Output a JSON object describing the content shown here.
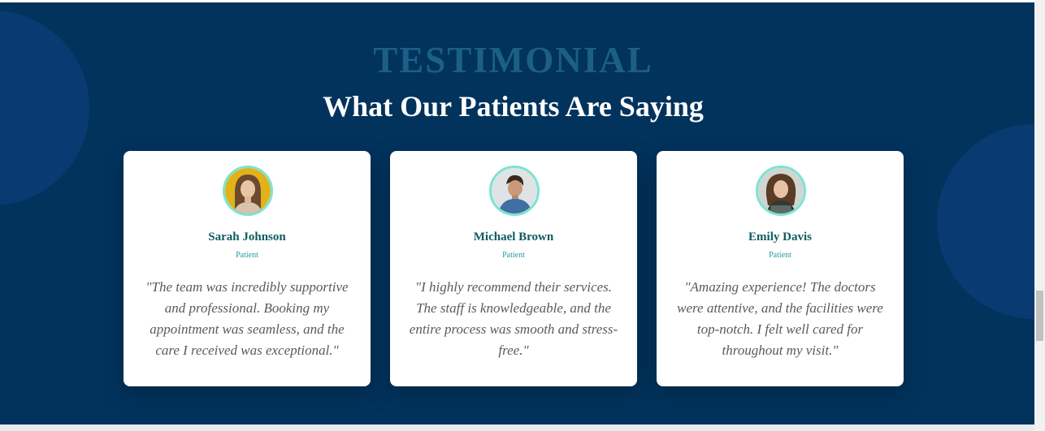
{
  "section": {
    "eyebrow": "TESTIMONIAL",
    "headline": "What Our Patients Are Saying"
  },
  "testimonials": [
    {
      "name": "Sarah Johnson",
      "role": "Patient",
      "quote": "\"The team was incredibly supportive and professional. Booking my appointment was seamless, and the care I received was exceptional.\""
    },
    {
      "name": "Michael Brown",
      "role": "Patient",
      "quote": "\"I highly recommend their services. The staff is knowledgeable, and the entire process was smooth and stress-free.\""
    },
    {
      "name": "Emily Davis",
      "role": "Patient",
      "quote": "\"Amazing experience! The doctors were attentive, and the facilities were top-notch. I felt well cared for throughout my visit.\""
    }
  ],
  "colors": {
    "section_bg": "#02335d",
    "eyebrow": "#1c5f87",
    "name": "#0f5c5e",
    "role": "#229ca1",
    "avatar_ring": "#7de3d2"
  }
}
